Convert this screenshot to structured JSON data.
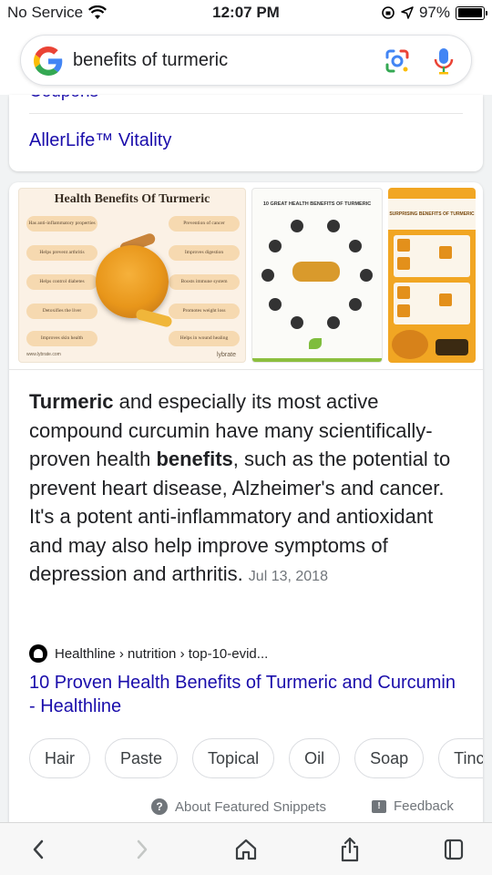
{
  "status_bar": {
    "carrier": "No Service",
    "time": "12:07 PM",
    "battery_percent": "97%",
    "battery_level": 0.97
  },
  "search": {
    "query": "benefits of turmeric"
  },
  "top_card": {
    "cut_link": "Coupons",
    "link": "AllerLife™ Vitality"
  },
  "images": {
    "thumb1": {
      "title": "Health Benefits Of Turmeric",
      "left_items": [
        "Has anti-inflammatory properties",
        "Helps prevent arthritis",
        "Helps control diabetes",
        "Detoxifies the liver",
        "Improves skin health"
      ],
      "right_items": [
        "Prevention of cancer",
        "Improves digestion",
        "Boosts immune system",
        "Promotes weight loss",
        "Helps in wound healing"
      ],
      "brand": "lybrate",
      "footer": "www.lybrate.com"
    },
    "thumb2": {
      "title": "10 GREAT HEALTH BENEFITS OF TURMERIC"
    },
    "thumb3": {
      "title": "SURPRISING BENEFITS OF TURMERIC"
    }
  },
  "snippet": {
    "part1_bold": "Turmeric",
    "part2": " and especially its most active compound curcumin have many scientifically-proven health ",
    "part3_bold": "benefits",
    "part4": ", such as the potential to prevent heart disease, Alzheimer's and cancer. It's a potent anti-inflammatory and antioxidant and may also help improve symptoms of depression and arthritis.",
    "date": "Jul 13, 2018"
  },
  "source": {
    "breadcrumb": "Healthline › nutrition › top-10-evid...",
    "title": "10 Proven Health Benefits of Turmeric and Curcumin - Healthline"
  },
  "chips": [
    "Hair",
    "Paste",
    "Topical",
    "Oil",
    "Soap",
    "Tinctu"
  ],
  "footer": {
    "about": "About Featured Snippets",
    "feedback": "Feedback"
  },
  "colors": {
    "link": "#1a0dab",
    "text": "#202124",
    "muted": "#70757a"
  }
}
